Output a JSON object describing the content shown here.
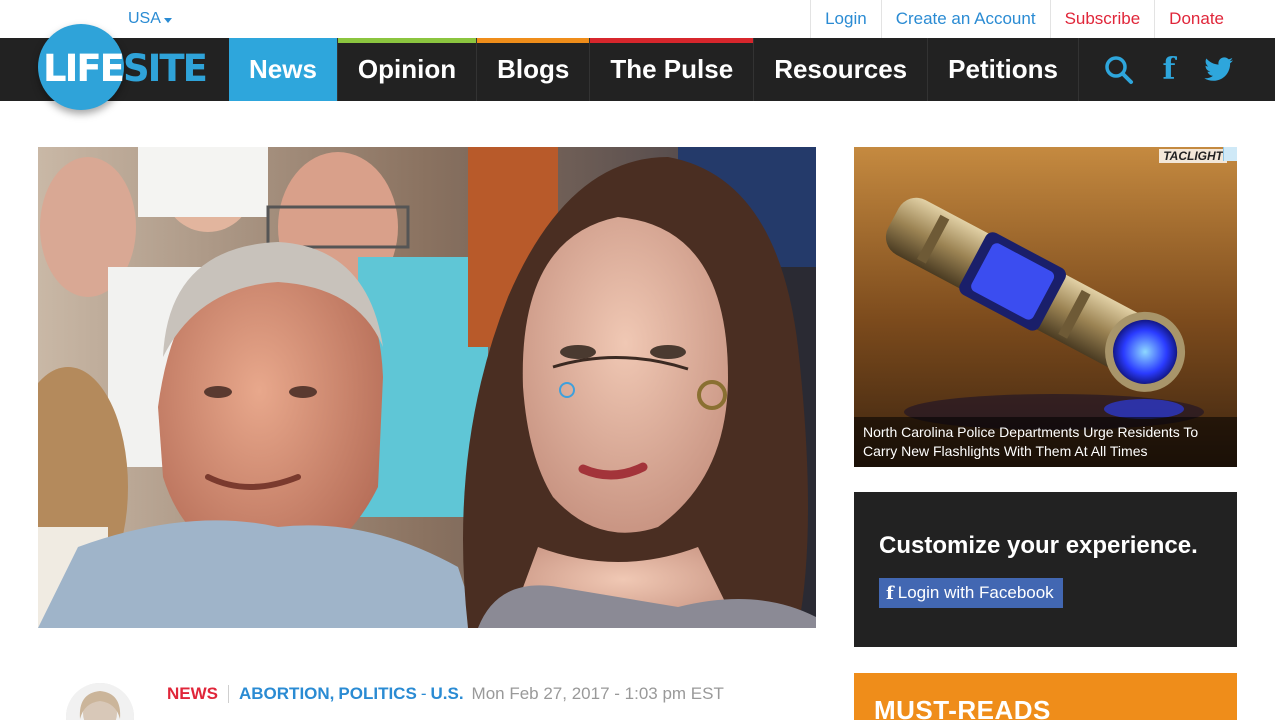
{
  "topbar": {
    "region": "USA",
    "links": [
      {
        "label": "Login",
        "color": "#2a8bd3"
      },
      {
        "label": "Create an Account",
        "color": "#2a8bd3"
      },
      {
        "label": "Subscribe",
        "color": "#e0263a"
      },
      {
        "label": "Donate",
        "color": "#e0263a"
      }
    ]
  },
  "logo": {
    "part1": "LIFE",
    "part2": "SITE"
  },
  "nav": {
    "items": [
      {
        "label": "News",
        "active": true,
        "stripe": ""
      },
      {
        "label": "Opinion",
        "active": false,
        "stripe": "#8bc53f"
      },
      {
        "label": "Blogs",
        "active": false,
        "stripe": "#ef8d1a"
      },
      {
        "label": "The Pulse",
        "active": false,
        "stripe": "#d7262c"
      },
      {
        "label": "Resources",
        "active": false,
        "stripe": ""
      },
      {
        "label": "Petitions",
        "active": false,
        "stripe": ""
      }
    ],
    "icons": [
      "search-icon",
      "facebook-icon",
      "twitter-icon"
    ]
  },
  "ad": {
    "brand": "TACLIGHT",
    "caption": "North Carolina Police Departments Urge Residents To Carry New Flashlights With Them At All Times"
  },
  "customize": {
    "title": "Customize your experience.",
    "button_label": "Login with Facebook"
  },
  "must_reads": {
    "title": "MUST-READS"
  },
  "article": {
    "category": "NEWS",
    "tags": [
      "ABORTION",
      "POLITICS",
      "U.S."
    ],
    "date": "Mon Feb 27, 2017 - 1:03 pm EST"
  },
  "colors": {
    "nav_bg": "#222222",
    "accent_blue": "#2ea6dc",
    "link_blue": "#2a8bd3",
    "alert_red": "#e0263a",
    "must_reads_orange": "#ef8d1a",
    "facebook_blue": "#4267b2"
  }
}
